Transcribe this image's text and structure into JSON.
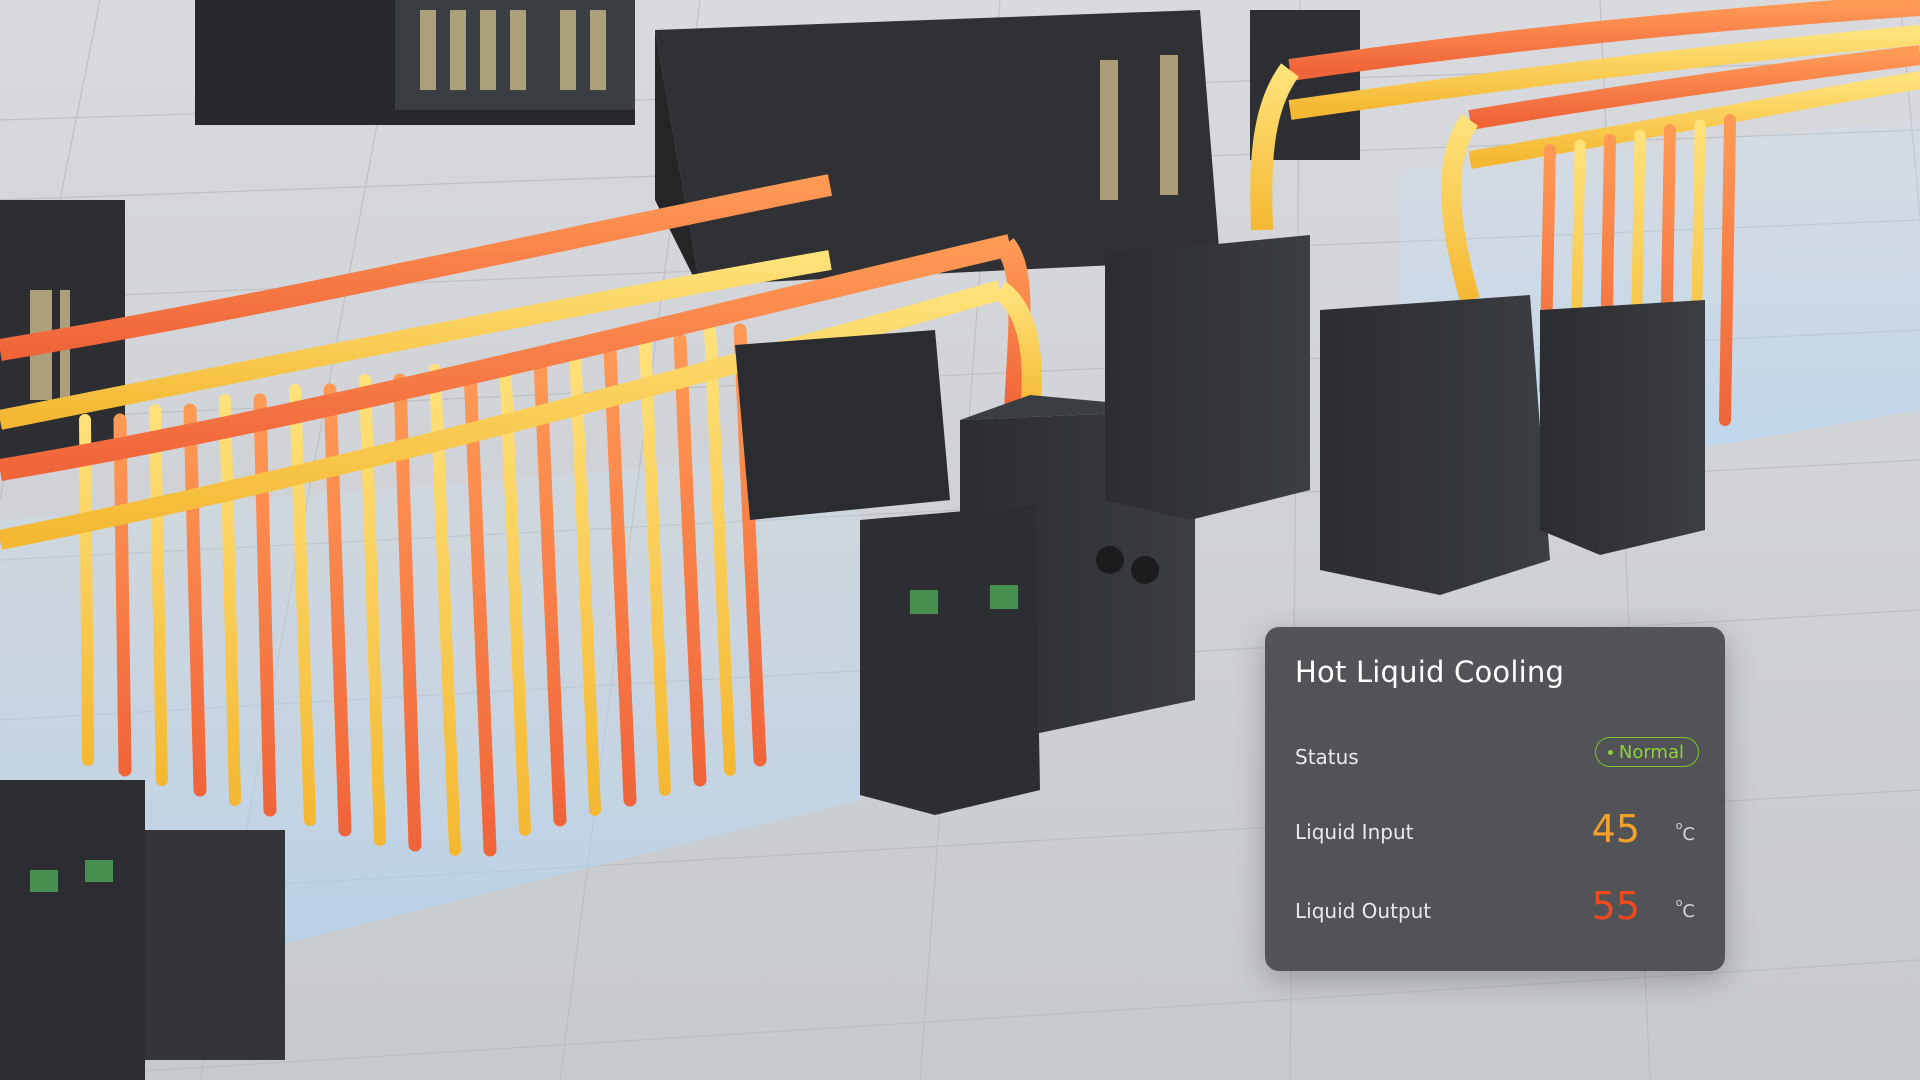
{
  "panel": {
    "title": "Hot Liquid Cooling",
    "status": {
      "label": "Status",
      "value": "Normal",
      "color": "#8fd33e"
    },
    "liquid_input": {
      "label": "Liquid Input",
      "value": "45",
      "unit_deg": "o",
      "unit_letter": "C",
      "color": "#f2a22a"
    },
    "liquid_output": {
      "label": "Liquid Output",
      "value": "55",
      "unit_deg": "o",
      "unit_letter": "C",
      "color": "#ef4a1d"
    }
  },
  "scene": {
    "description_icon": "data-center-liquid-cooling-render",
    "pipe_colors": {
      "hot": "#f2783a",
      "warm": "#f6c53a",
      "cold": "#bfe3ff"
    }
  }
}
